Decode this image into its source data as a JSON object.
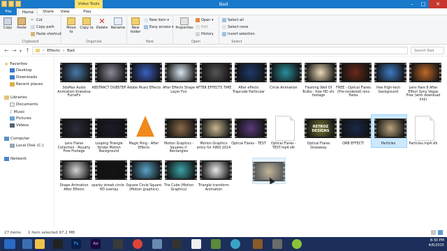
{
  "window": {
    "title": "Bad",
    "context_tab": "Video Tools"
  },
  "tabs": [
    "File",
    "Home",
    "Share",
    "View",
    "Play"
  ],
  "ribbon": {
    "clipboard": {
      "copy": "Copy",
      "paste": "Paste",
      "cut": "Cut",
      "copy_path": "Copy path",
      "paste_shortcut": "Paste shortcut",
      "label": "Clipboard"
    },
    "organize": {
      "move_to": "Move to",
      "copy_to": "Copy to",
      "delete": "Delete",
      "rename": "Rename",
      "label": "Organize"
    },
    "new": {
      "new_folder": "New folder",
      "new_item": "New item ▾",
      "easy_access": "Easy access ▾",
      "label": "New"
    },
    "open": {
      "properties": "Properties",
      "open": "Open ▾",
      "edit": "Edit",
      "history": "History",
      "label": "Open"
    },
    "select": {
      "select_all": "Select all",
      "select_none": "Select none",
      "invert": "Invert selection",
      "label": "Select"
    }
  },
  "address": {
    "path": [
      "Effects",
      "Bad"
    ],
    "search_placeholder": "Search Bad"
  },
  "nav": {
    "favorites": "Favorites",
    "desktop": "Desktop",
    "downloads": "Downloads",
    "recent": "Recent places",
    "libraries": "Libraries",
    "documents": "Documents",
    "music": "Music",
    "pictures": "Pictures",
    "videos": "Videos",
    "computer": "Computer",
    "local_disk": "Local Disk (C:)",
    "network": "Network"
  },
  "files": [
    {
      "name": "3dsMax Audio Animation Krakatoa FumeFx",
      "kind": "video",
      "color": "#4a7aa8"
    },
    {
      "name": "ABSTRACT DUBSTEP",
      "kind": "video",
      "color": "#8a8a9a"
    },
    {
      "name": "Adobe Music Effects",
      "kind": "video",
      "color": "#3a5fc0"
    },
    {
      "name": "After Effects Shape Layer Fun",
      "kind": "video",
      "color": "#d9e6ef"
    },
    {
      "name": "AFTER EFFECTS TIME",
      "kind": "video",
      "color": "#555555"
    },
    {
      "name": "After effects Trapcode Particular",
      "kind": "video",
      "color": "#1d3a6b"
    },
    {
      "name": "Circle Animation",
      "kind": "video",
      "color": "#2a8f9c"
    },
    {
      "name": "Flashing Wall Of Bulbs - free HD vfx footage",
      "kind": "video",
      "color": "#e9d9b4"
    },
    {
      "name": "FREE - Optical Flares (Pre-rendered) lens flares",
      "kind": "video",
      "color": "#6a2a1a"
    },
    {
      "name": "free High-tech background",
      "kind": "video",
      "color": "#3e7cc4"
    },
    {
      "name": "Lens flare 8 After Effect Sony Vegas Free (with download link)",
      "kind": "video",
      "color": "#c06a2a"
    },
    {
      "name": "Lens Flares Collection - Royalty Free Footage",
      "kind": "video",
      "color": "#2d2d3d"
    },
    {
      "name": "Looping Triangle Strobe Motion Background",
      "kind": "video",
      "color": "#1c1c2c"
    },
    {
      "name": "Magic Ring - After Effects",
      "kind": "vlc",
      "color": "#f08a1c"
    },
    {
      "name": "Motion Graphics - Squares n' Rectangles",
      "kind": "video",
      "color": "#8a6a4a"
    },
    {
      "name": "Motion Graphics entry for XINO 2014",
      "kind": "video",
      "color": "#c8b890"
    },
    {
      "name": "Optical Flares - TEST",
      "kind": "video",
      "color": "#5a3a7a"
    },
    {
      "name": "Optical Flares - TEST.mp4.sfk",
      "kind": "doc",
      "color": "#ffffff"
    },
    {
      "name": "Optical Flares Giveaway",
      "kind": "video",
      "color": "#7a7a3a"
    },
    {
      "name": "ORB EFFECT!",
      "kind": "video",
      "color": "#1a2a4a"
    },
    {
      "name": "Particles",
      "kind": "video",
      "color": "#b8a27a"
    },
    {
      "name": "Particles.mp4.sfk",
      "kind": "doc",
      "color": "#ffffff"
    },
    {
      "name": "Shape Animation After Effects",
      "kind": "video",
      "color": "#d4d4d4"
    },
    {
      "name": "sparky streak circle - HD overlay",
      "kind": "video",
      "color": "#141414"
    },
    {
      "name": "Square Circle Square (Motion graphics)",
      "kind": "video",
      "color": "#5aa4c8"
    },
    {
      "name": "The Cube (Motion Graphics)",
      "kind": "video",
      "color": "#3aa3a8"
    },
    {
      "name": "Triangle transform Animation",
      "kind": "video",
      "color": "#eaeaea"
    }
  ],
  "thumb_texts": {
    "optical_giveaway": "RETROZ DESIGNS"
  },
  "status": {
    "count": "27 items",
    "selected": "1 item selected  97.2 MB"
  },
  "tray": {
    "time": "8:30 PM",
    "date": "4/6/2015"
  }
}
